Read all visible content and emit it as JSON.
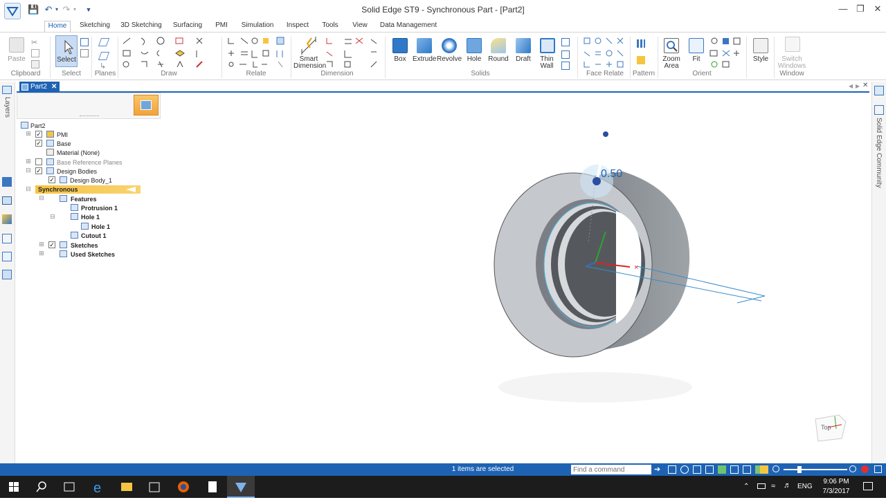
{
  "window": {
    "title": "Solid Edge ST9 - Synchronous Part - [Part2]"
  },
  "tabs": [
    "Home",
    "Sketching",
    "3D Sketching",
    "Surfacing",
    "PMI",
    "Simulation",
    "Inspect",
    "Tools",
    "View",
    "Data Management"
  ],
  "ribbon": {
    "groups": [
      "Clipboard",
      "Select",
      "Planes",
      "Draw",
      "Relate",
      "Dimension",
      "Solids",
      "Face Relate",
      "Pattern",
      "Orient",
      "Window"
    ],
    "buttons": {
      "paste": "Paste",
      "select": "Select",
      "smart_dimension_1": "Smart",
      "smart_dimension_2": "Dimension",
      "box": "Box",
      "extrude": "Extrude",
      "revolve": "Revolve",
      "hole": "Hole",
      "round": "Round",
      "draft": "Draft",
      "thin_wall_1": "Thin",
      "thin_wall_2": "Wall",
      "zoom_area_1": "Zoom",
      "zoom_area_2": "Area",
      "fit": "Fit",
      "style": "Style",
      "switch_windows_1": "Switch",
      "switch_windows_2": "Windows"
    }
  },
  "document_tab": "Part2",
  "left_panel": {
    "layers_label": "Layers"
  },
  "right_panel": {
    "community_label": "Solid Edge Community"
  },
  "tree": {
    "root": "Part2",
    "pmi": "PMI",
    "base": "Base",
    "material": "Material (None)",
    "base_ref_planes": "Base Reference Planes",
    "design_bodies": "Design Bodies",
    "design_body_1": "Design Body_1",
    "synchronous": "Synchronous",
    "features": "Features",
    "protrusion_1": "Protrusion 1",
    "hole_1": "Hole 1",
    "hole_1_child": "Hole 1",
    "cutout_1": "Cutout 1",
    "sketches": "Sketches",
    "used_sketches": "Used Sketches"
  },
  "viewport": {
    "dimension_value": "0.50",
    "view_cube_label": "Top"
  },
  "statusbar": {
    "text": "1 items are selected",
    "command_placeholder": "Find a command"
  },
  "taskbar": {
    "language": "ENG",
    "time": "9:06 PM",
    "date": "7/3/2017"
  },
  "colors": {
    "accent": "#1e63b3",
    "taskbar": "#1c1c1c",
    "highlight": "#f6c343"
  }
}
